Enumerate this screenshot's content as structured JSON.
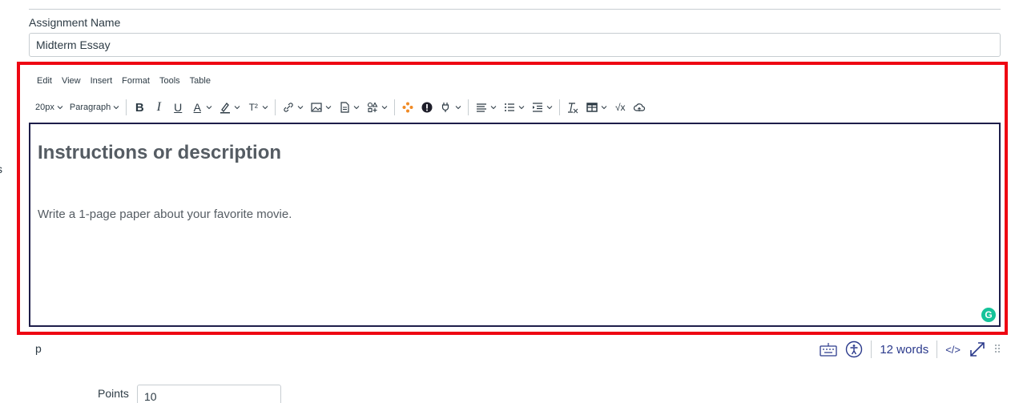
{
  "assignment": {
    "label": "Assignment Name",
    "value": "Midterm Essay"
  },
  "side_glyph": "s",
  "menubar": [
    "Edit",
    "View",
    "Insert",
    "Format",
    "Tools",
    "Table"
  ],
  "toolbar": {
    "font_size": "20px",
    "block_format": "Paragraph",
    "bold": "B",
    "italic": "I",
    "underline": "U",
    "text_color": "A",
    "superscript": "T²",
    "equation": "√x"
  },
  "editor": {
    "heading": "Instructions or description",
    "body": "Write a 1-page paper about your favorite movie.",
    "grammarly": "G"
  },
  "status": {
    "element_path": "p",
    "word_count": "12 words",
    "html_toggle": "</>"
  },
  "points": {
    "label": "Points",
    "value": "10"
  },
  "colors": {
    "highlight": "#ee0612",
    "editor_border": "#1e1e4a",
    "accent": "#2b3a8c",
    "grammarly": "#15c39a",
    "apps": "#f08a24"
  }
}
